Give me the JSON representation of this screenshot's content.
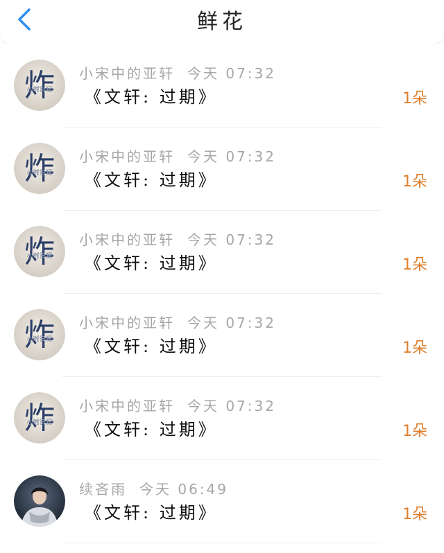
{
  "header": {
    "title": "鲜花",
    "back_icon": "chevron-left-icon",
    "accent": "#2f8cf3"
  },
  "colors": {
    "count": "#e07d2a",
    "meta": "#a6a6a6"
  },
  "items": [
    {
      "user": "小宋中的亚轩",
      "time": "今天 07:32",
      "message": "《文轩: 过期》",
      "count": "1朵",
      "avatar": "logo"
    },
    {
      "user": "小宋中的亚轩",
      "time": "今天 07:32",
      "message": "《文轩: 过期》",
      "count": "1朵",
      "avatar": "logo"
    },
    {
      "user": "小宋中的亚轩",
      "time": "今天 07:32",
      "message": "《文轩: 过期》",
      "count": "1朵",
      "avatar": "logo"
    },
    {
      "user": "小宋中的亚轩",
      "time": "今天 07:32",
      "message": "《文轩: 过期》",
      "count": "1朵",
      "avatar": "logo"
    },
    {
      "user": "小宋中的亚轩",
      "time": "今天 07:32",
      "message": "《文轩: 过期》",
      "count": "1朵",
      "avatar": "logo"
    },
    {
      "user": "续吝雨",
      "time": "今天 06:49",
      "message": "《文轩: 过期》",
      "count": "1朵",
      "avatar": "photo"
    }
  ],
  "avatar_text": {
    "logo_big": "炸",
    "logo_small": "小时日记"
  }
}
